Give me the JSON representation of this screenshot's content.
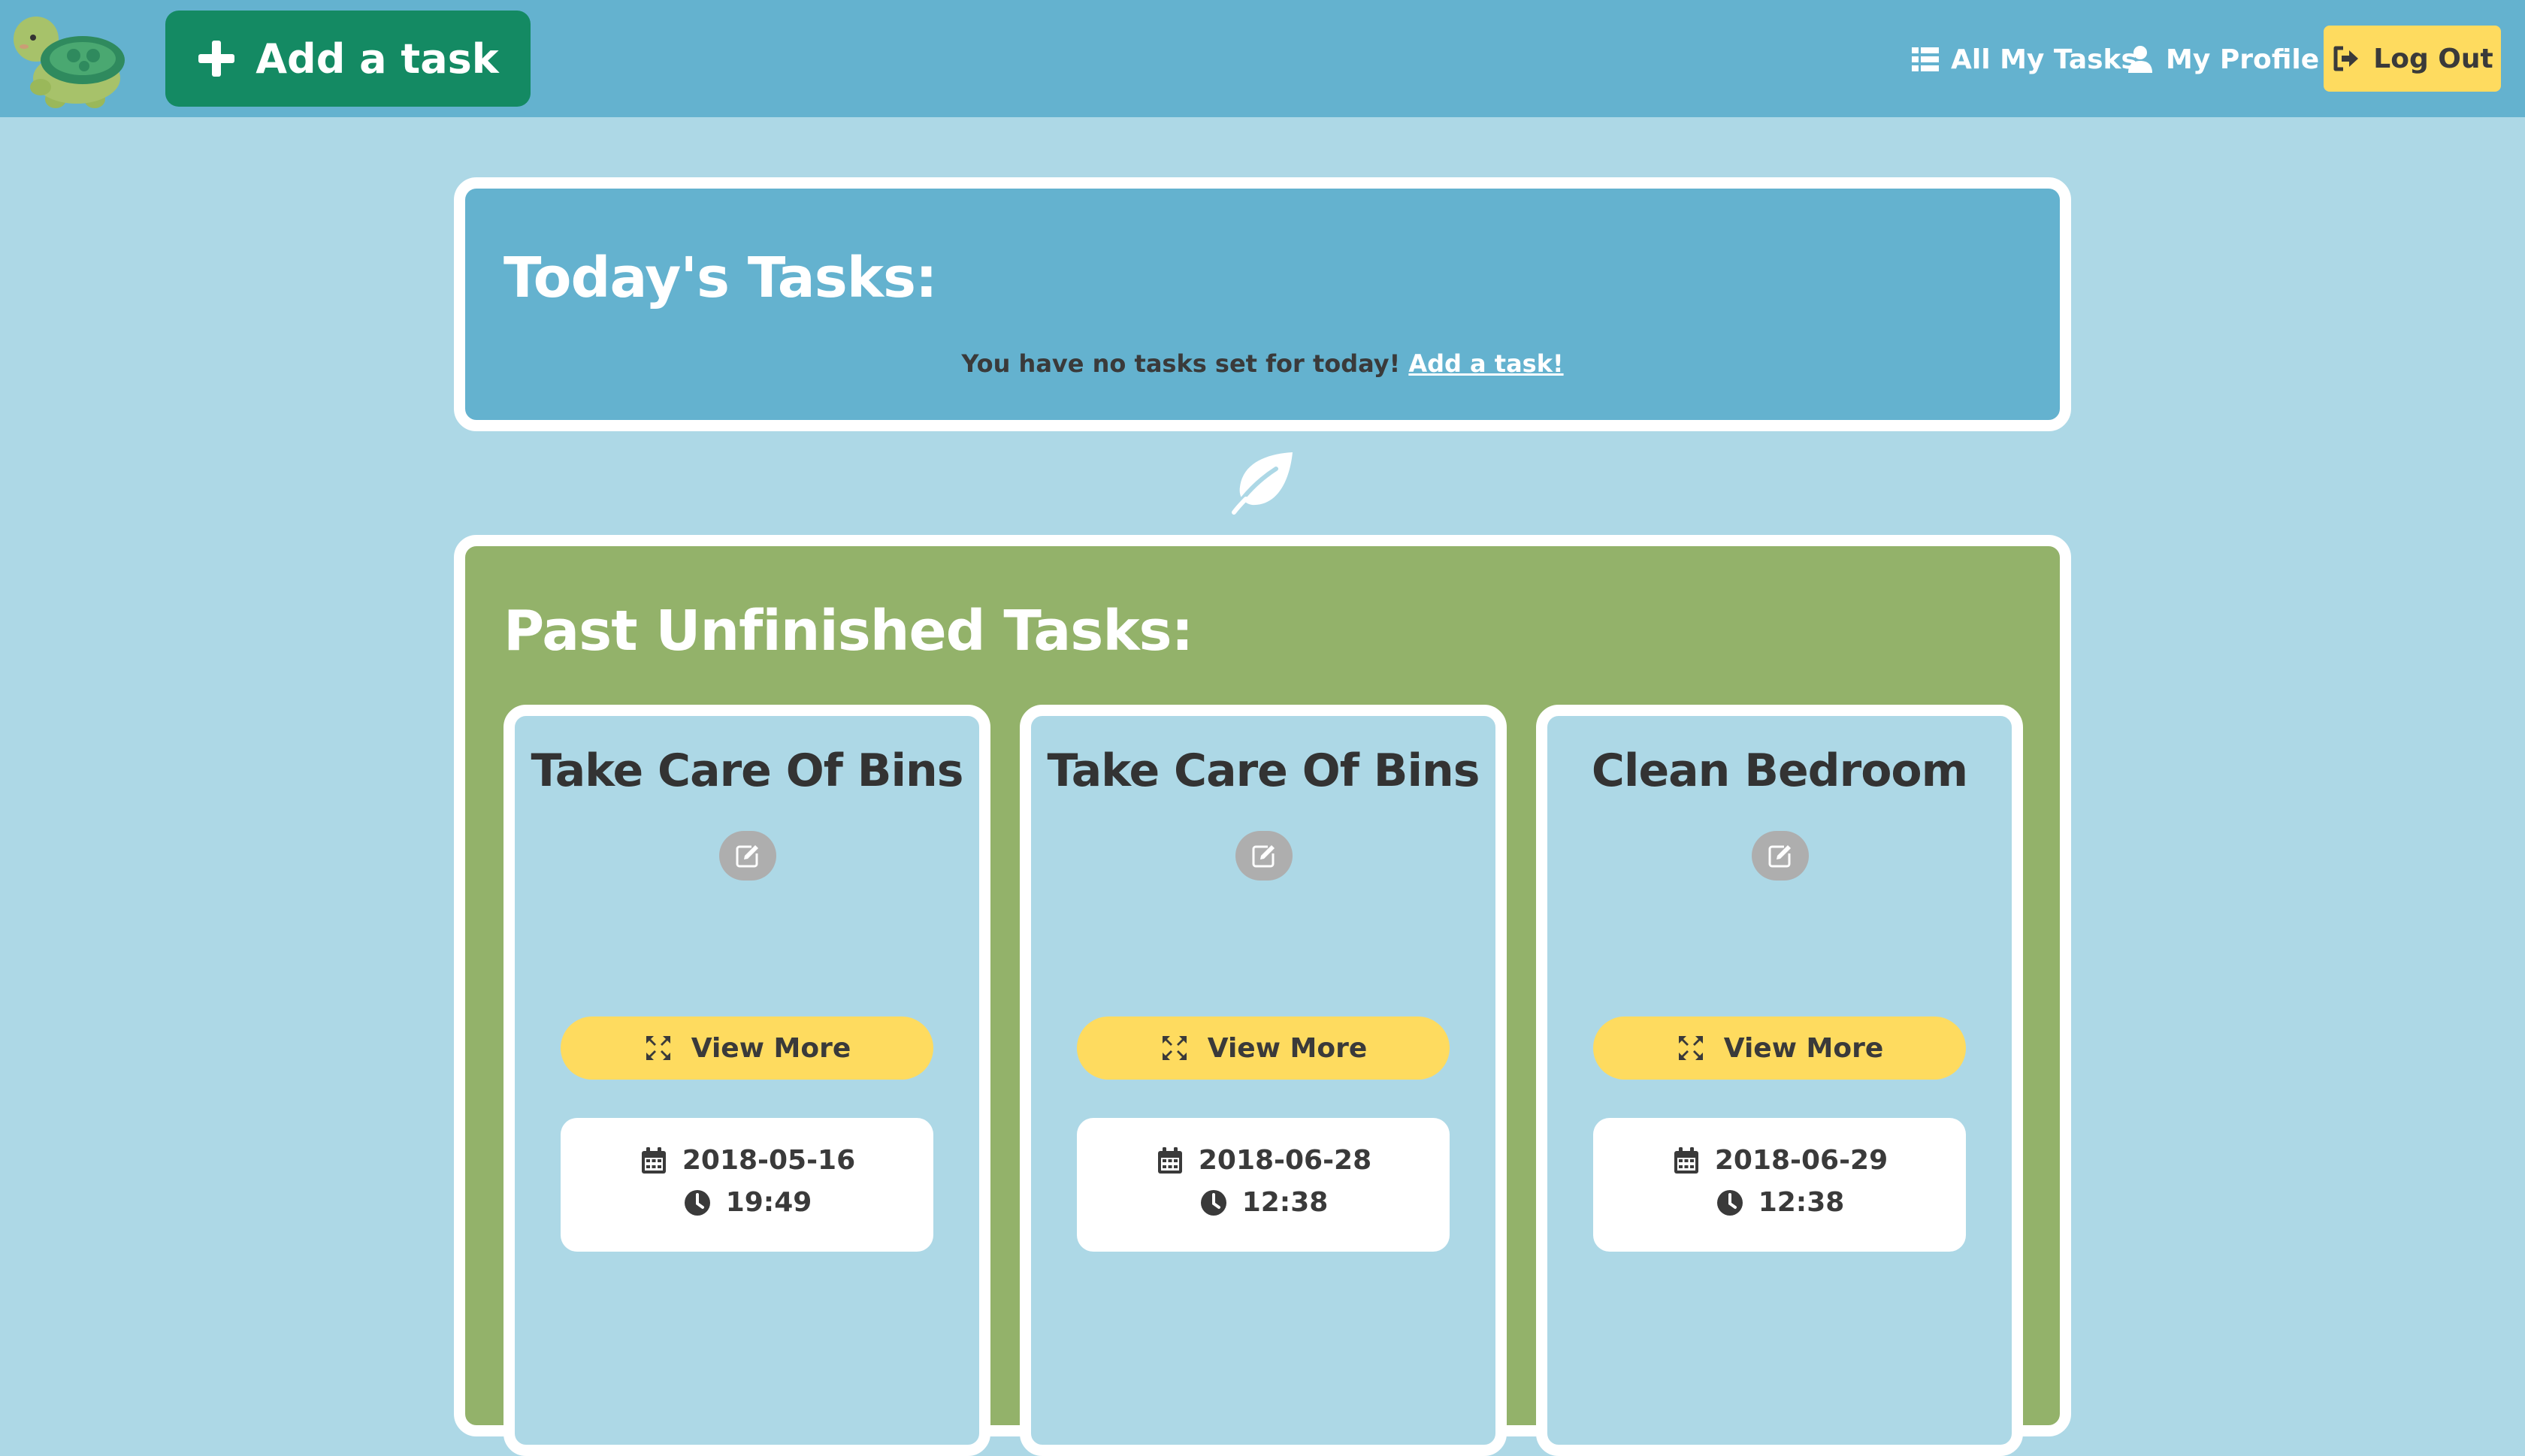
{
  "navbar": {
    "add_task_label": "Add a task",
    "links": [
      {
        "label": "All My Tasks",
        "icon": "list-icon"
      },
      {
        "label": "My Profile",
        "icon": "user-icon"
      }
    ],
    "logout_label": "Log Out"
  },
  "today": {
    "title": "Today's Tasks:",
    "message": "You have no tasks set for today!",
    "link_label": "Add a task!"
  },
  "past": {
    "title": "Past Unfinished Tasks:",
    "tasks": [
      {
        "title": "Take Care Of Bins",
        "view_label": "View More",
        "date": "2018-05-16",
        "time": "19:49"
      },
      {
        "title": "Take Care Of Bins",
        "view_label": "View More",
        "date": "2018-06-28",
        "time": "12:38"
      },
      {
        "title": "Clean Bedroom",
        "view_label": "View More",
        "date": "2018-06-29",
        "time": "12:38"
      }
    ]
  },
  "colors": {
    "page_bg": "#add8e6",
    "navbar_bg": "#64b2cf",
    "add_button": "#148a63",
    "logout_button": "#fedb5f",
    "today_panel": "#64b2cf",
    "past_panel": "#93b26a",
    "card_bg": "#add8e6",
    "view_more_button": "#fedb5f",
    "edit_button": "#aeaeae"
  }
}
